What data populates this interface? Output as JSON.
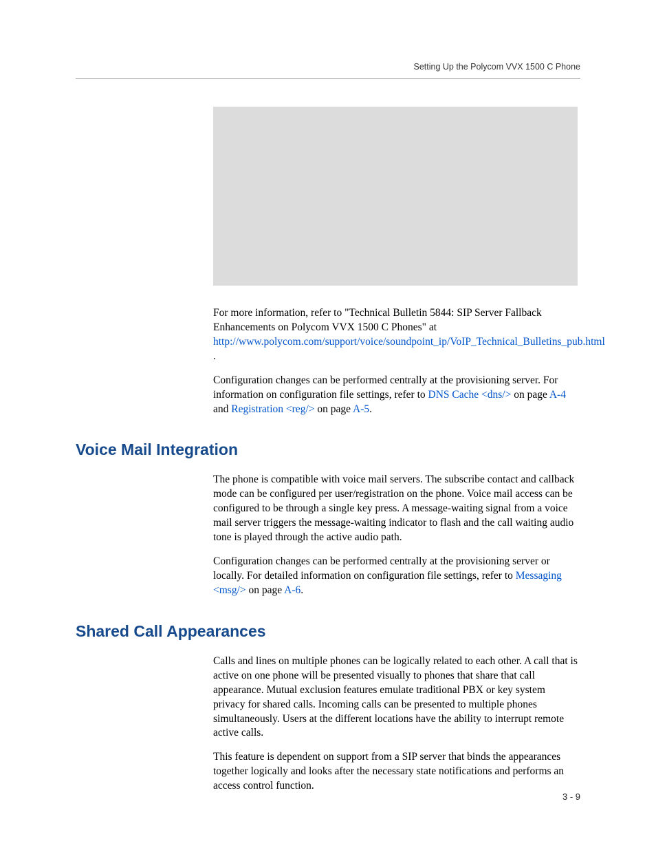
{
  "header": "Setting Up the Polycom VVX 1500 C Phone",
  "p1_a": "For more information, refer to \"Technical Bulletin 5844: SIP Server Fallback Enhancements on Polycom VVX 1500 C Phones\" at ",
  "link1": "http://www.polycom.com/support/voice/soundpoint_ip/VoIP_Technical_Bulletins_pub.html",
  "p1_b": " .",
  "p2_a": "Configuration changes can be performed centrally at the provisioning server. For information on configuration file settings, refer to ",
  "link2": "DNS Cache <dns/>",
  "p2_b": " on page ",
  "link3": "A-4",
  "p2_c": " and ",
  "link4": "Registration <reg/>",
  "p2_d": " on page ",
  "link5": "A-5",
  "p2_e": ".",
  "h1": "Voice Mail Integration",
  "p3": "The phone is compatible with voice mail servers. The subscribe contact and callback mode can be configured per user/registration on the phone. Voice mail access can be configured to be through a single key press. A message-waiting signal from a voice mail server triggers the message-waiting indicator to flash and the call waiting audio tone is played through the active audio path.",
  "p4_a": "Configuration changes can be performed centrally at the provisioning server or locally. For detailed information on configuration file settings, refer to ",
  "link6": "Messaging <msg/>",
  "p4_b": " on page ",
  "link7": "A-6",
  "p4_c": ".",
  "h2": "Shared Call Appearances",
  "p5": "Calls and lines on multiple phones can be logically related to each other. A call that is active on one phone will be presented visually to phones that share that call appearance. Mutual exclusion features emulate traditional PBX or key system privacy for shared calls. Incoming calls can be presented to multiple phones simultaneously. Users at the different locations have the ability to interrupt remote active calls.",
  "p6": "This feature is dependent on support from a SIP server that binds the appearances together logically and looks after the necessary state notifications and performs an access control function.",
  "pagenum": "3 - 9"
}
